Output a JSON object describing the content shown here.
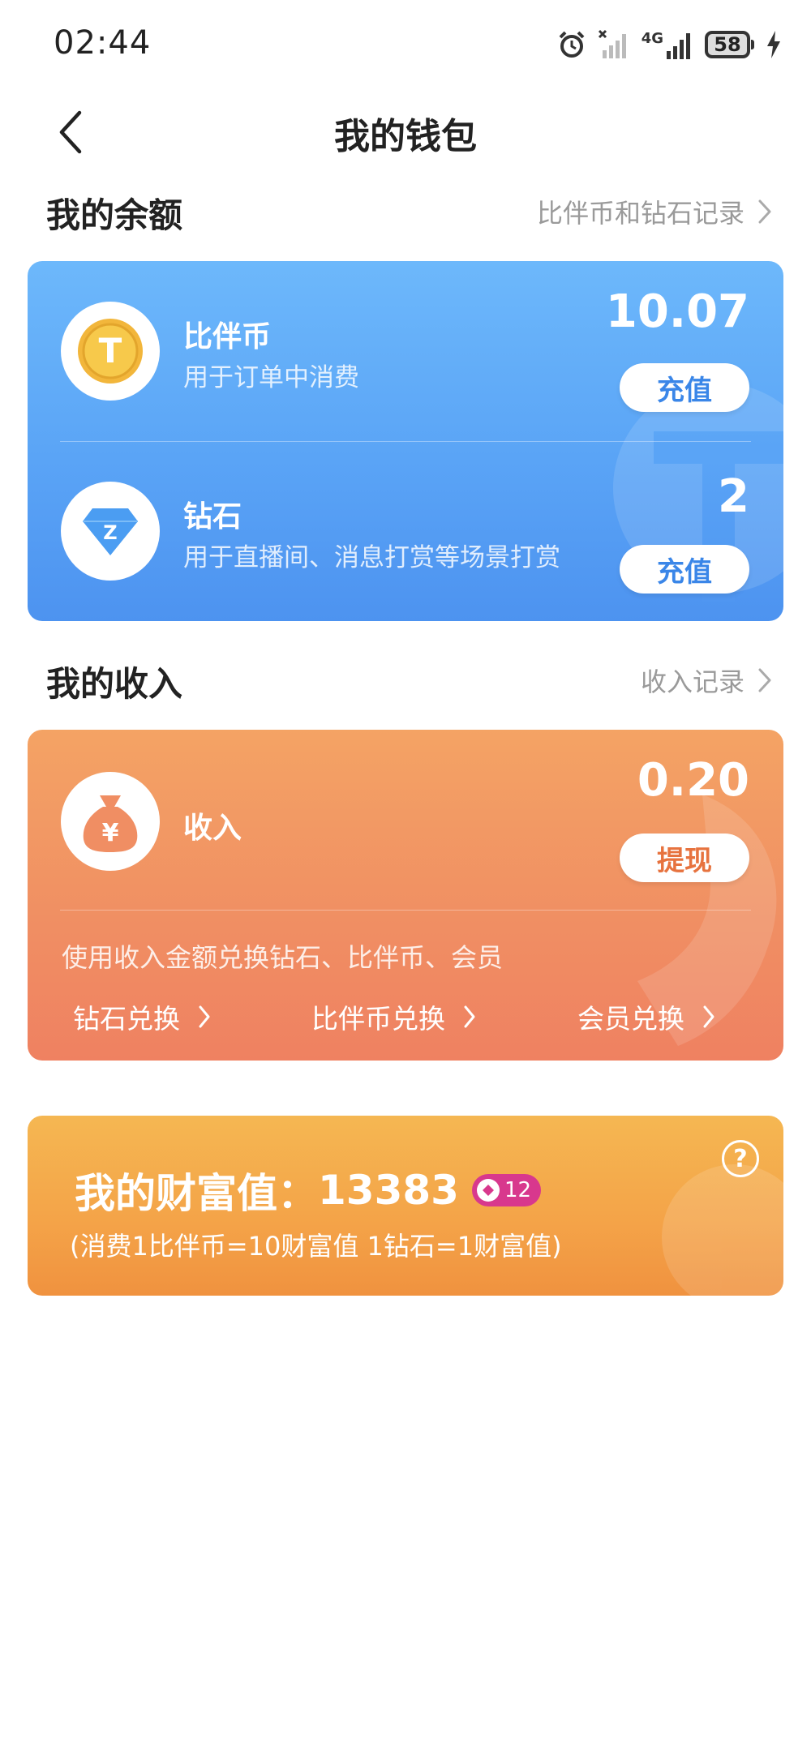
{
  "status_bar": {
    "time": "02:44",
    "network": "4G",
    "battery": "58"
  },
  "header": {
    "title": "我的钱包"
  },
  "balance_section": {
    "title": "我的余额",
    "link": "比伴币和钻石记录",
    "coin": {
      "icon_letter": "T",
      "name": "比伴币",
      "desc": "用于订单中消费",
      "amount": "10.07",
      "button": "充值"
    },
    "diamond": {
      "icon_letter": "Z",
      "name": "钻石",
      "desc": "用于直播间、消息打赏等场景打赏",
      "amount": "2",
      "button": "充值"
    }
  },
  "income_section": {
    "title": "我的收入",
    "link": "收入记录",
    "income": {
      "icon_symbol": "¥",
      "name": "收入",
      "amount": "0.20",
      "button": "提现"
    },
    "exchange_note": "使用收入金额兑换钻石、比伴币、会员",
    "exchanges": [
      "钻石兑换",
      "比伴币兑换",
      "会员兑换"
    ]
  },
  "wealth": {
    "label": "我的财富值：",
    "value": "13383",
    "badge_level": "12",
    "note": "(消费1比伴币=10财富值 1钻石=1财富值)"
  },
  "colors": {
    "balance_card": "#5aa4f6",
    "income_card": "#f08e63",
    "wealth_card": "#f4a348",
    "badge": "#d8388d"
  }
}
